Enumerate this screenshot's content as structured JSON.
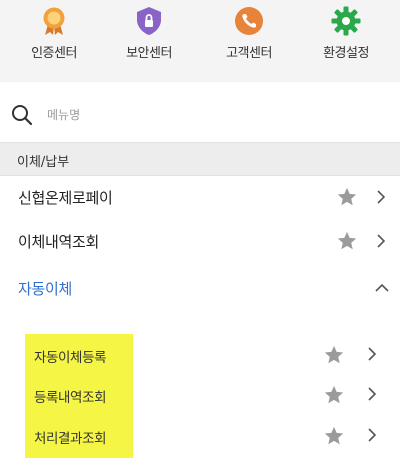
{
  "top_menu": [
    {
      "label": "인증센터",
      "icon": "certificate-medal-icon",
      "color": "#e0902a"
    },
    {
      "label": "보안센터",
      "icon": "security-shield-icon",
      "color": "#8a63c9"
    },
    {
      "label": "고객센터",
      "icon": "phone-icon",
      "color": "#e8833a"
    },
    {
      "label": "환경설정",
      "icon": "gear-icon",
      "color": "#2aa84a"
    }
  ],
  "search": {
    "placeholder": "메뉴명",
    "value": ""
  },
  "section": {
    "title": "이체/납부"
  },
  "menu_items": [
    {
      "label": "신협온제로페이",
      "favorite": false
    },
    {
      "label": "이체내역조회",
      "favorite": false
    }
  ],
  "expanded_item": {
    "label": "자동이체",
    "color": "#2f6fcf",
    "expanded": true
  },
  "sub_items": [
    {
      "label": "자동이체등록",
      "favorite": false
    },
    {
      "label": "등록내역조회",
      "favorite": false
    },
    {
      "label": "처리결과조회",
      "favorite": false
    }
  ],
  "colors": {
    "highlight": "#f5f545",
    "star": "#9b9b9b",
    "chevron": "#555555"
  }
}
